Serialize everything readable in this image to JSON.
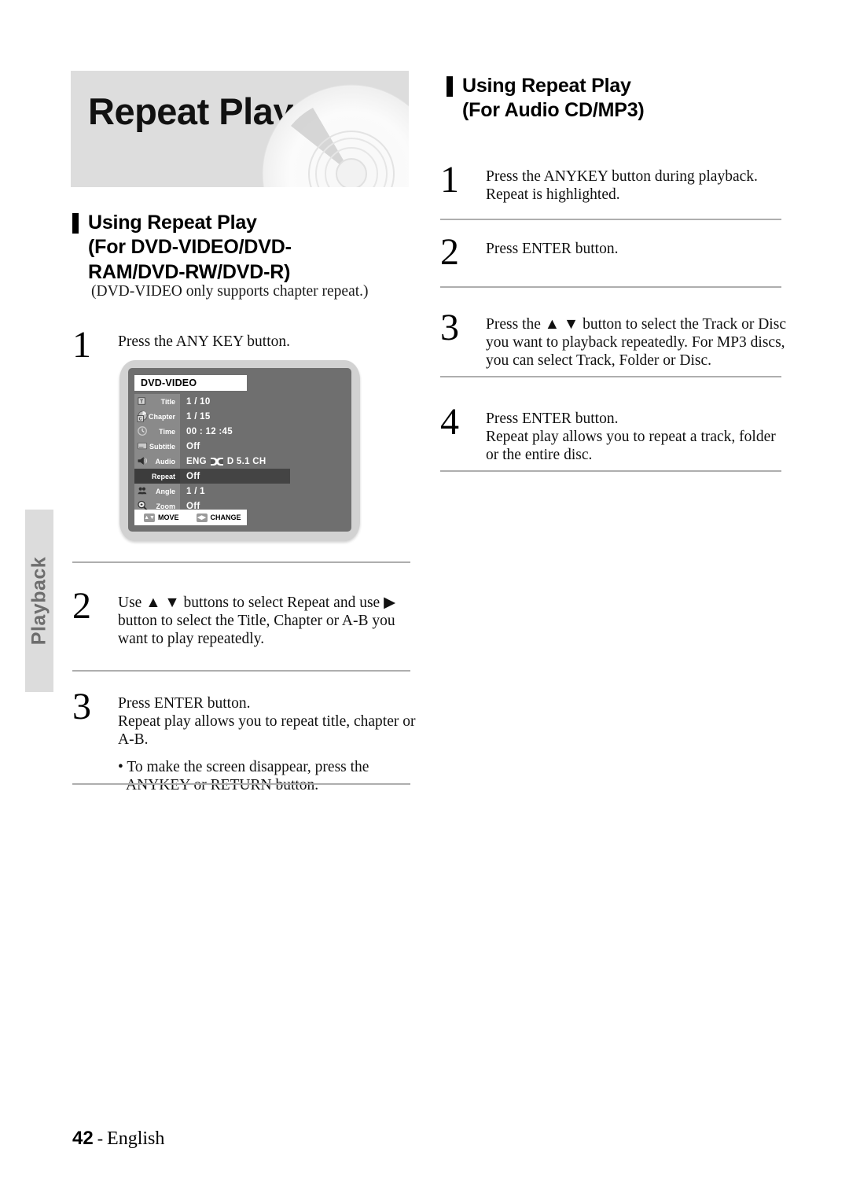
{
  "side_tab": {
    "label": "Playback"
  },
  "banner": {
    "title": "Repeat Play",
    "disc_icon": "compact-disc-icon"
  },
  "left_column": {
    "heading": {
      "line1": "Using Repeat Play",
      "line2": "(For DVD-VIDEO/DVD-RAM/DVD-RW/DVD-R)"
    },
    "note": "(DVD-VIDEO only supports chapter repeat.)",
    "steps": [
      {
        "num": "1",
        "text": "Press the ANY KEY button."
      },
      {
        "num": "2",
        "text": "Use ▲ ▼ buttons to select Repeat and use ▶ button to select the Title, Chapter or A-B you want to play repeatedly."
      },
      {
        "num": "3",
        "text": "Press ENTER button.\nRepeat play allows you to repeat title, chapter or A-B.",
        "bullet": "• To make the screen disappear, press the ANYKEY or RETURN button."
      }
    ]
  },
  "right_column": {
    "heading": {
      "line1": "Using Repeat Play",
      "line2": "(For Audio CD/MP3)"
    },
    "steps": [
      {
        "num": "1",
        "text": "Press the ANYKEY button during playback.\nRepeat is highlighted."
      },
      {
        "num": "2",
        "text": "Press ENTER button."
      },
      {
        "num": "3",
        "text": "Press the ▲ ▼ button to select the Track or Disc you want to playback repeatedly.  For MP3 discs, you can select Track, Folder or Disc."
      },
      {
        "num": "4",
        "text": "Press ENTER button.\nRepeat play allows you to repeat a track, folder or the entire disc."
      }
    ]
  },
  "osd": {
    "disc_type": "DVD-VIDEO",
    "rows": [
      {
        "icon": "title-icon",
        "label": "Title",
        "value": "1 / 10",
        "selected": false
      },
      {
        "icon": "chapter-icon",
        "label": "Chapter",
        "value": "1 / 15",
        "selected": false
      },
      {
        "icon": "clock-icon",
        "label": "Time",
        "value": "00 : 12 :45",
        "selected": false
      },
      {
        "icon": "subtitle-icon",
        "label": "Subtitle",
        "value": "Off",
        "selected": false
      },
      {
        "icon": "speaker-icon",
        "label": "Audio",
        "value": "ENG",
        "value_suffix": "D 5.1 CH",
        "dolby": true,
        "selected": false
      },
      {
        "icon": "repeat-icon",
        "label": "Repeat",
        "value": "Off",
        "selected": true
      },
      {
        "icon": "angle-icon",
        "label": "Angle",
        "value": "1 / 1",
        "selected": false
      },
      {
        "icon": "zoom-icon",
        "label": "Zoom",
        "value": "Off",
        "selected": false
      }
    ],
    "legend": {
      "move": "MOVE",
      "change": "CHANGE",
      "move_key": "updown-arrows-icon",
      "change_key": "leftright-arrows-icon"
    }
  },
  "footer": {
    "page_number": "42",
    "separator": "-",
    "language": "English"
  },
  "colors": {
    "banner_bg": "#dddddd",
    "screen_bg": "#6f6f6f",
    "label_bg": "#8a8a8a",
    "selected_bg": "#3c3c3c",
    "rule": "#aeaeae",
    "tab_bg": "#dcdcdc"
  }
}
